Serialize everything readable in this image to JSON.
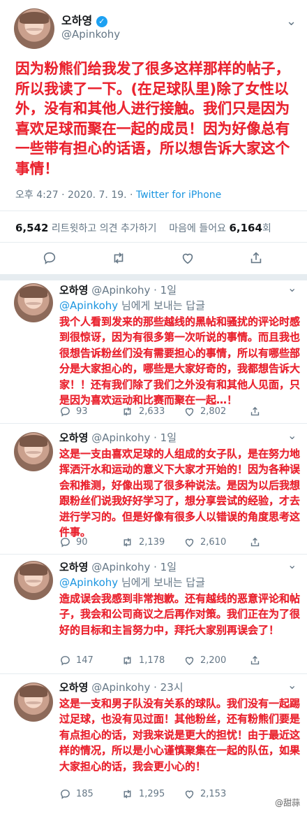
{
  "main_tweet": {
    "name": "오하영",
    "handle": "@Apinkohy",
    "text": "因为粉熊们给我发了很多这样那样的帖子，所以我读了一下。(在足球队里)除了女性以外，没有和其他人进行接触。我们只是因为喜欢足球而聚在一起的成员！因为好像总有一些带有担心的话语，所以想告诉大家这个事情！",
    "time": "오후 4:27 · 2020. 7. 19. · ",
    "source": "Twitter for iPhone",
    "retweets": "6,542",
    "retweets_label": " 리트윗하고 의견 추가하기",
    "likes_label": "마음에 들어요 ",
    "likes": "6,164",
    "likes_suffix": "회"
  },
  "replies": [
    {
      "name": "오하영",
      "handle": "@Apinkohy · 1일",
      "reply_to": "@Apinkohy",
      "reply_to_suffix": " 님에게 보내는 답글",
      "text": "我个人看到发来的那些越线的黑帖和骚扰的评论时感到很惊讶，因为有很多第一次听说的事情。而且我也很想告诉粉丝们没有需要担心的事情，所以有哪些部分是大家担心的，哪些是大家好奇的，我都想告诉大家！！还有我们除了我们之外没有和其他人见面，只是因为喜欢运动和比赛而聚在一起…！",
      "comments": "93",
      "retweets": "2,633",
      "likes": "2,802"
    },
    {
      "name": "오하영",
      "handle": "@Apinkohy · 1일",
      "reply_to": "",
      "reply_to_suffix": "",
      "text": "这是一支由喜欢足球的人组成的女子队，是在努力地挥洒汗水和运动的意义下大家才开始的！因为各种误会和推测，好像出现了很多种说法。是因为以后我想跟粉丝们说我好好学习了，想分享尝试的经验，才去进行学习的。但是好像有很多人以错误的角度思考这件事。",
      "comments": "90",
      "retweets": "2,139",
      "likes": "2,610"
    },
    {
      "name": "오하영",
      "handle": "@Apinkohy · 1일",
      "reply_to": "@Apinkohy",
      "reply_to_suffix": " 님에게 보내는 답글",
      "text": "造成误会我感到非常抱歉。还有越线的恶意评论和帖子，我会和公司商议之后再作对策。我们正在为了很好的目标和主旨努力中，拜托大家别再误会了！",
      "comments": "147",
      "retweets": "1,178",
      "likes": "2,200"
    },
    {
      "name": "오하영",
      "handle": "@Apinkohy · 23시",
      "reply_to": "",
      "reply_to_suffix": "",
      "text": "这是一支和男子队没有关系的球队。我们没有一起踢过足球，也没有见过面！其他粉丝，还有粉熊们要是有点担心的话，对我来说是更大的担忧！由于最近这样的情况，所以是小心谨慎聚集在一起的队伍，如果大家担心的话，我会更小心的！",
      "comments": "185",
      "retweets": "1,295",
      "likes": "2,153"
    }
  ],
  "watermark": "@甜蒜",
  "colors": {
    "accent": "#1da1f2",
    "caption_red": "#ea2430",
    "muted": "#657786",
    "divider": "#e6ecf0"
  },
  "icons": [
    "verified-badge-icon",
    "chevron-down-icon",
    "reply-icon",
    "retweet-icon",
    "like-icon",
    "share-icon"
  ]
}
